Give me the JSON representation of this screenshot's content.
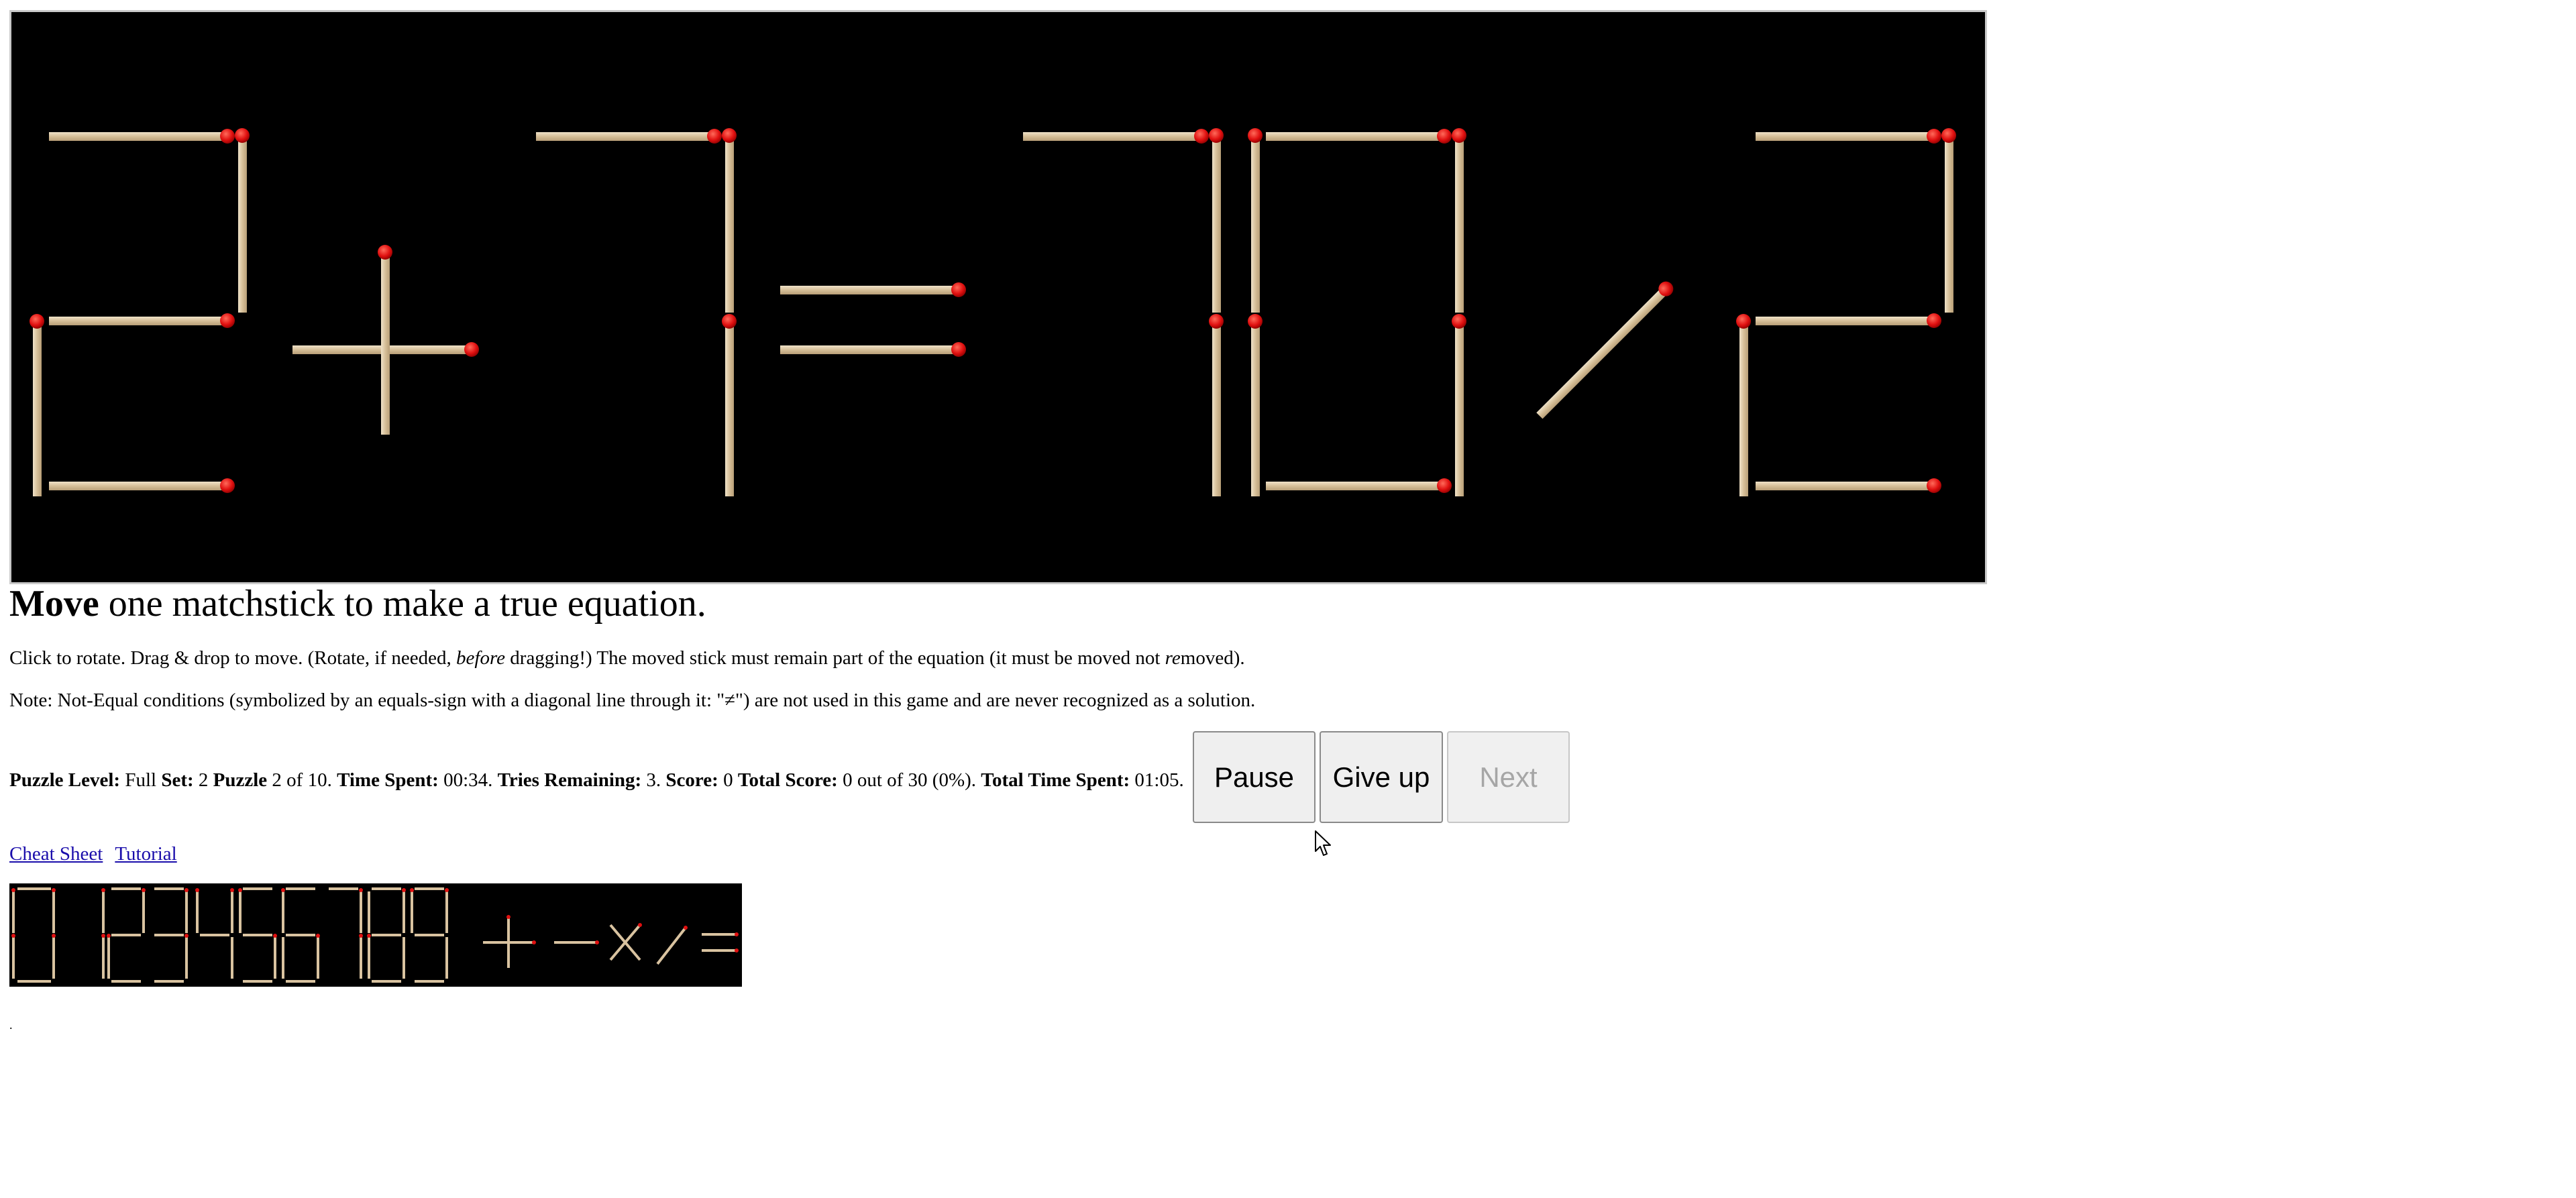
{
  "game": {
    "equation_display": "2+7=70/2",
    "cheat_sheet_glyphs": "0 123456789+-×/="
  },
  "instructions": {
    "title_bold": "Move",
    "title_rest": " one matchstick to make a true equation.",
    "line1_a": "Click to rotate. Drag & drop to move. (Rotate, if needed, ",
    "line1_em": "before",
    "line1_b": " dragging!) The moved stick must remain part of the equation (it must be moved not ",
    "line1_em2": "re",
    "line1_c": "moved).",
    "line2": "Note: Not-Equal conditions (symbolized by an equals-sign with a diagonal line through it: \"≠\") are not used in this game and are never recognized as a solution."
  },
  "status": {
    "level_label": "Puzzle Level:",
    "level_value": " Full ",
    "set_label": "Set:",
    "set_value": " 2 ",
    "puzzle_label": "Puzzle",
    "puzzle_value": " 2 of 10. ",
    "time_label": "Time Spent:",
    "time_value": " 00:34. ",
    "tries_label": "Tries Remaining:",
    "tries_value": " 3. ",
    "score_label": "Score:",
    "score_value": " 0 ",
    "total_label": "Total Score:",
    "total_value": " 0 out of 30 (0%). ",
    "total_time_label": "Total Time Spent:",
    "total_time_value": " 01:05."
  },
  "buttons": {
    "pause": "Pause",
    "give_up": "Give up",
    "next": "Next"
  },
  "links": {
    "cheat_sheet": "Cheat Sheet",
    "tutorial": "Tutorial"
  },
  "footer": {
    "dot": "."
  },
  "colors": {
    "stick": "#d9c3a0",
    "stick_head": "#e01010",
    "board_bg": "#000000",
    "link": "#1a0dab"
  }
}
